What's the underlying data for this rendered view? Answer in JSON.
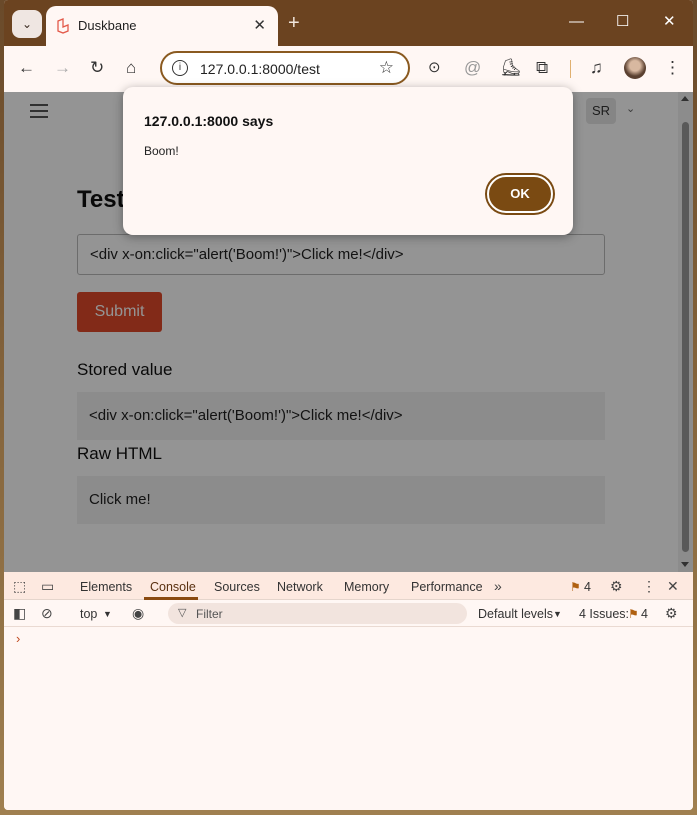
{
  "browser": {
    "tab_title": "Duskbane",
    "url": "127.0.0.1:8000/test",
    "new_tab_glyph": "+",
    "minimize_glyph": "—",
    "maximize_glyph": "☐",
    "close_glyph": "✕"
  },
  "page": {
    "title": "Test",
    "input_value": "<div x-on:click=\"alert('Boom!')\">Click me!</div>",
    "submit_label": "Submit",
    "stored_heading": "Stored value",
    "stored_value": "<div x-on:click=\"alert('Boom!')\">Click me!</div>",
    "raw_heading": "Raw HTML",
    "raw_value": "Click me!",
    "user_initials": "SR"
  },
  "dialog": {
    "title": "127.0.0.1:8000 says",
    "message": "Boom!",
    "ok_label": "OK"
  },
  "devtools": {
    "tabs": [
      "Elements",
      "Console",
      "Sources",
      "Network",
      "Memory",
      "Performance"
    ],
    "active_tab": "Console",
    "issues_badge_count": "4",
    "context": "top",
    "filter_placeholder": "Filter",
    "levels": "Default levels",
    "issues_label": "4 Issues:",
    "issues_count": "4",
    "prompt": "›"
  },
  "colors": {
    "accent_brown": "#7a4a12",
    "submit_red": "#e0492a",
    "titlebar": "#6b4320"
  }
}
